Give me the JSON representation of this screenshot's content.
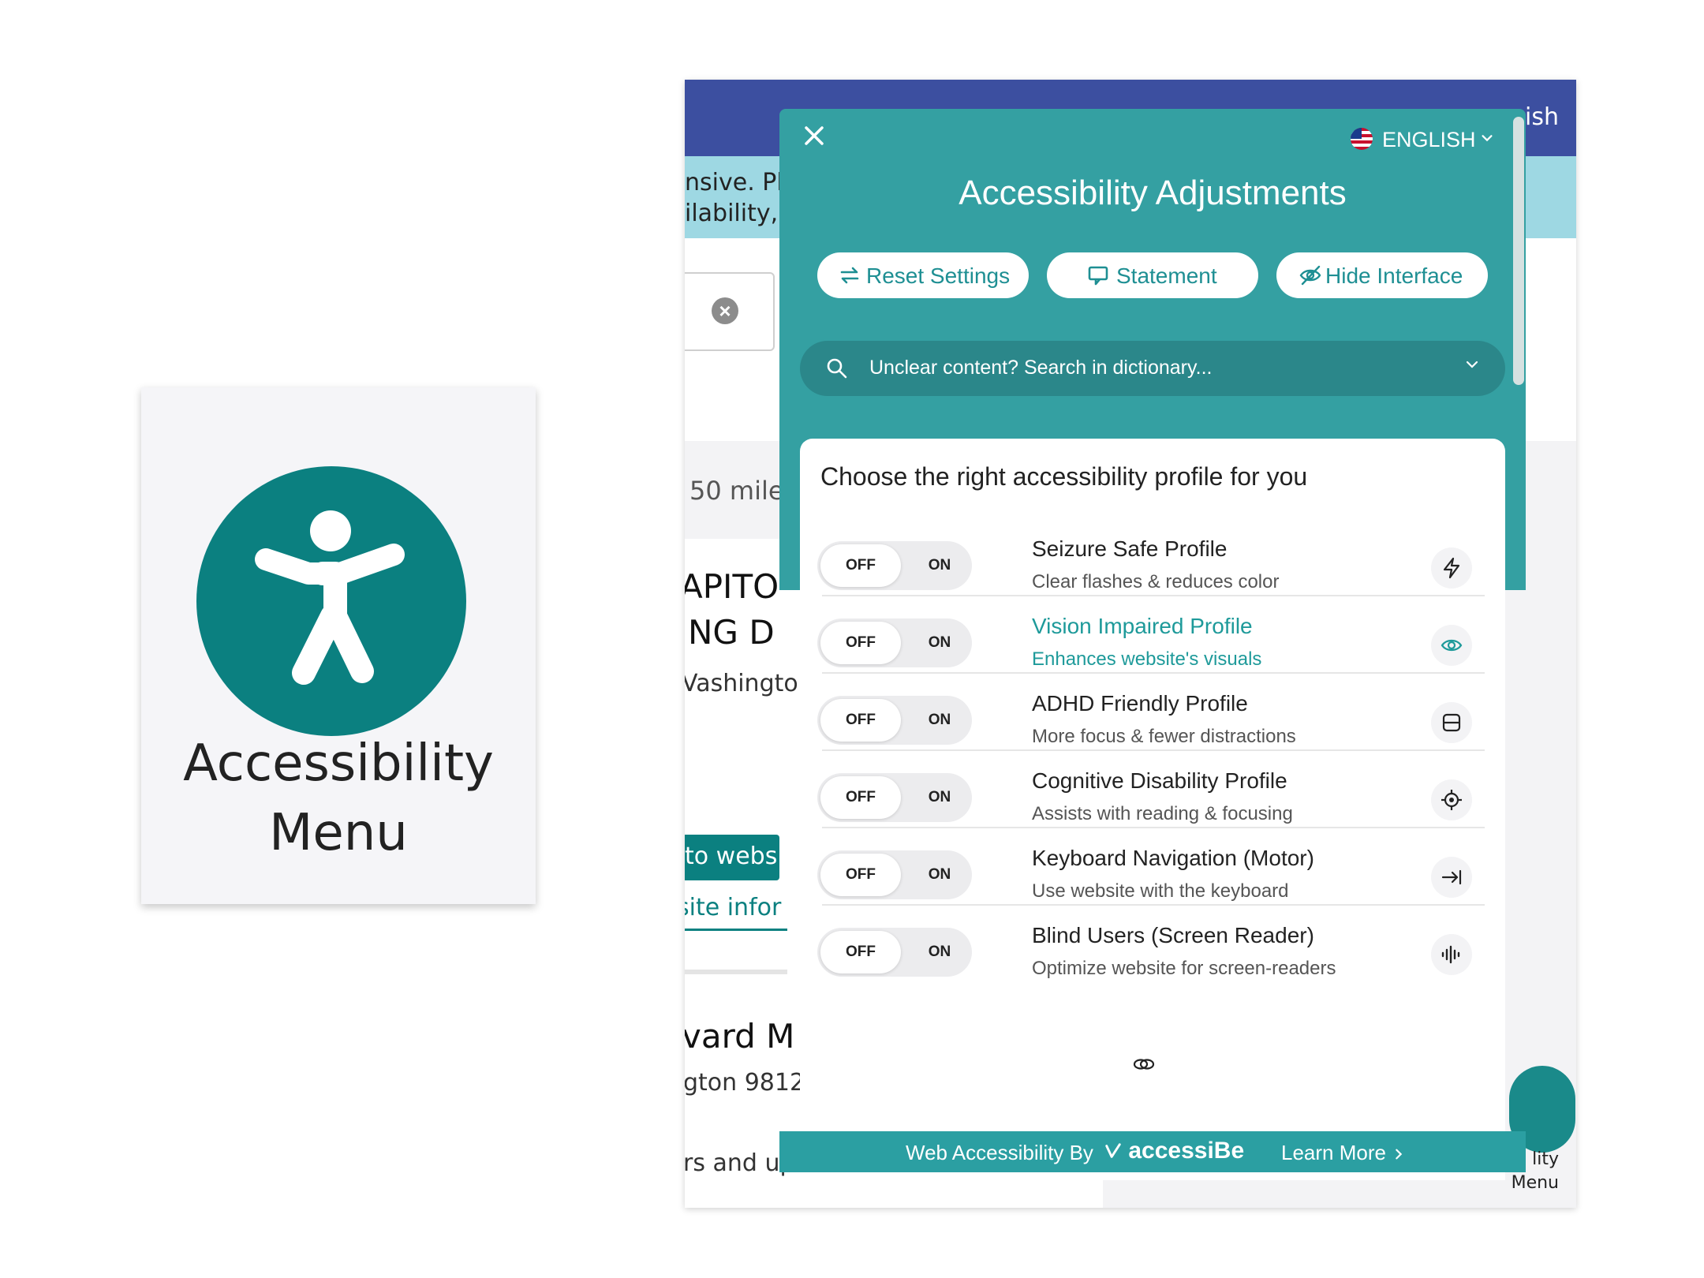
{
  "card": {
    "line1": "Accessibility",
    "line2": "Menu"
  },
  "site": {
    "lang_fragment": "ish",
    "notice_line1": "nsive. Plea",
    "notice_line2": "ilability, a",
    "distance": "50 miles",
    "listing_line1": "APITO",
    "listing_line2": "NG D",
    "listing_city": "Vashingto",
    "website_button": "to website",
    "site_info_link": "site infor",
    "listing2_title": "vard M",
    "listing2_city": "gton 9812",
    "listing2_hours": "rs and up",
    "float_label_1": "lity",
    "float_label_2": "Menu"
  },
  "panel": {
    "language": "ENGLISH",
    "title": "Accessibility Adjustments",
    "buttons": [
      {
        "label": "Reset Settings",
        "icon": "reset-icon"
      },
      {
        "label": "Statement",
        "icon": "statement-icon"
      },
      {
        "label": "Hide Interface",
        "icon": "eye-off-icon"
      }
    ],
    "dictionary_placeholder": "Unclear content? Search in dictionary...",
    "profiles_heading": "Choose the right accessibility profile for you",
    "toggle_off": "OFF",
    "toggle_on": "ON",
    "profiles": [
      {
        "title": "Seizure Safe Profile",
        "subtitle": "Clear flashes & reduces color",
        "icon": "lightning-icon",
        "state": "OFF"
      },
      {
        "title": "Vision Impaired Profile",
        "subtitle": "Enhances website's visuals",
        "icon": "eye-icon",
        "state": "OFF",
        "highlighted": true
      },
      {
        "title": "ADHD Friendly Profile",
        "subtitle": "More focus & fewer distractions",
        "icon": "focus-frame-icon",
        "state": "OFF"
      },
      {
        "title": "Cognitive Disability Profile",
        "subtitle": "Assists with reading & focusing",
        "icon": "target-icon",
        "state": "OFF"
      },
      {
        "title": "Keyboard Navigation (Motor)",
        "subtitle": "Use website with the keyboard",
        "icon": "arrow-to-line-icon",
        "state": "OFF"
      },
      {
        "title": "Blind Users (Screen Reader)",
        "subtitle": "Optimize website for screen-readers",
        "icon": "audio-wave-icon",
        "state": "OFF"
      }
    ],
    "footer": {
      "text": "Web Accessibility By",
      "brand": "accessiBe",
      "learn_more": "Learn More"
    }
  },
  "colors": {
    "teal": "#34a0a2",
    "brand_teal": "#0b8080",
    "site_header": "#3c4fa0",
    "notice": "#9ed8e3",
    "accent_text": "#1e9a9a"
  }
}
